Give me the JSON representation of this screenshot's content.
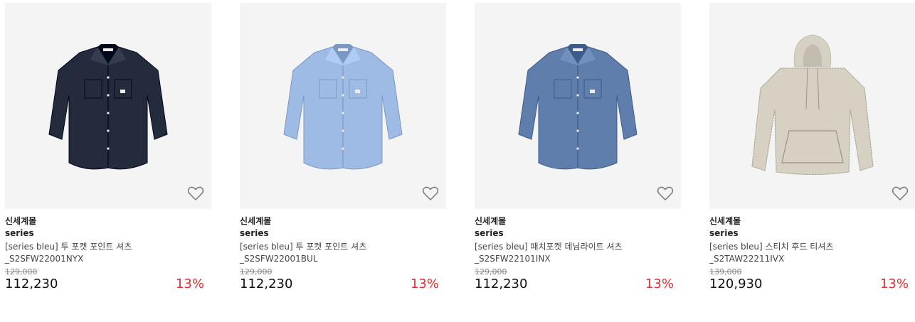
{
  "products": [
    {
      "mall": "신세계몰",
      "brand": "series",
      "name_line1": "[series bleu] 투 포켓 포인트 셔츠",
      "name_line2": "_S2SFW22001NYX",
      "original_price": "129,000",
      "price": "112,230",
      "discount": "13%",
      "garment": "shirt",
      "color": "#232b3d",
      "image_icon": "navy-shirt-image",
      "wish_icon": "heart-outline-icon"
    },
    {
      "mall": "신세계몰",
      "brand": "series",
      "name_line1": "[series bleu] 투 포켓 포인트 셔츠",
      "name_line2": "_S2SFW22001BUL",
      "original_price": "129,000",
      "price": "112,230",
      "discount": "13%",
      "garment": "shirt",
      "color": "#9dbbe4",
      "image_icon": "light-blue-shirt-image",
      "wish_icon": "heart-outline-icon"
    },
    {
      "mall": "신세계몰",
      "brand": "series",
      "name_line1": "[series bleu] 패치포켓 데님라이트 셔츠",
      "name_line2": "_S2SFW22101INX",
      "original_price": "129,000",
      "price": "112,230",
      "discount": "13%",
      "garment": "shirt",
      "color": "#5f7eab",
      "image_icon": "denim-shirt-image",
      "wish_icon": "heart-outline-icon"
    },
    {
      "mall": "신세계몰",
      "brand": "series",
      "name_line1": "[series bleu] 스티치 후드 티셔츠",
      "name_line2": "_S2TAW22211IVX",
      "original_price": "139,000",
      "price": "120,930",
      "discount": "13%",
      "garment": "hoodie",
      "color": "#d6d1c2",
      "image_icon": "beige-hoodie-image",
      "wish_icon": "heart-outline-icon"
    }
  ],
  "colors": {
    "thumb_bg": "#f4f4f4",
    "discount": "#e02d2d",
    "strike": "#888888"
  }
}
